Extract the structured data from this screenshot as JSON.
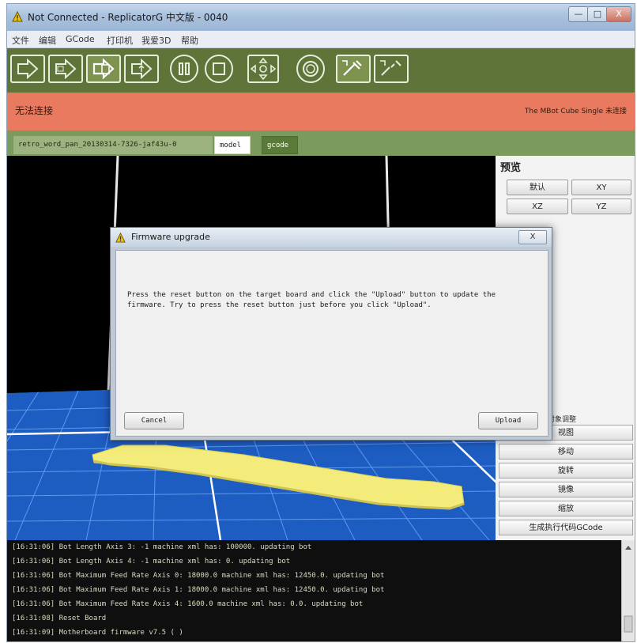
{
  "window": {
    "title": "Not Connected - ReplicatorG 中文版 - 0040",
    "controls": {
      "minimize": "—",
      "maximize": "□",
      "close": "X"
    }
  },
  "menu": [
    "文件",
    "编辑",
    "GCode",
    "打印机",
    "我爱3D",
    "帮助"
  ],
  "toolbar": {
    "background": "#5f7438",
    "icons": [
      "simulate-icon",
      "build-icon",
      "build-to-file-icon",
      "upload-icon",
      "pause-icon",
      "stop-icon",
      "control-panel-icon",
      "reset-icon",
      "connect-icon",
      "disconnect-icon"
    ]
  },
  "status": {
    "left": "无法连接",
    "right": "The MBot Cube Single 未连接",
    "color": "#ea7a5f"
  },
  "tabs": {
    "file": "retro_word_pan_20130314-7326-jaf43u-0",
    "model": "model",
    "gcode": "gcode"
  },
  "right_panel": {
    "heading": "预览",
    "view_buttons": [
      "默认",
      "XY",
      "XZ",
      "YZ"
    ],
    "section_label": "对象调整",
    "actions": [
      "视图",
      "移动",
      "旋转",
      "镜像",
      "缩放",
      "生成执行代码GCode"
    ]
  },
  "console": {
    "lines": [
      "[16:31:06] Bot Length Axis 3: -1 machine xml has: 100000. updating bot",
      "[16:31:06] Bot Length Axis 4: -1 machine xml has: 0. updating bot",
      "[16:31:06] Bot Maximum Feed Rate Axis 0: 18000.0 machine xml has: 12450.0. updating bot",
      "[16:31:06] Bot Maximum Feed Rate Axis 1: 18000.0 machine xml has: 12450.0. updating bot",
      "[16:31:06] Bot Maximum Feed Rate Axis 4: 1600.0 machine xml has: 0.0. updating bot",
      "[16:31:08] Reset Board",
      "[16:31:09] Motherboard firmware v7.5 ( )"
    ]
  },
  "dialog": {
    "title": "Firmware upgrade",
    "close_label": "X",
    "message": "Press the reset button on the target board and click the \"Upload\" button to update the firmware. Try to press the reset button just before you click \"Upload\".",
    "cancel": "Cancel",
    "upload": "Upload"
  },
  "colors": {
    "toolbar_green": "#5f7438",
    "tab_green": "#7b9a5e",
    "grid_blue": "#1e5fc0",
    "model_yellow": "#f4ec7a"
  }
}
